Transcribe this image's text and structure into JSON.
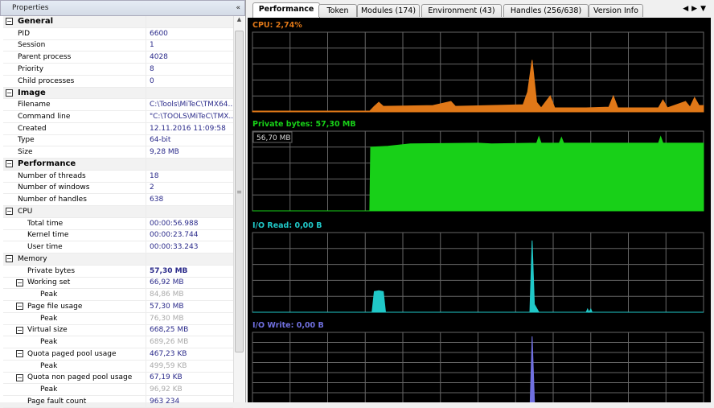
{
  "properties_panel": {
    "title": "Properties",
    "collapse_icon": "«",
    "rows": [
      {
        "k": "cat",
        "name": "General"
      },
      {
        "name": "PID",
        "value": "6600"
      },
      {
        "name": "Session",
        "value": "1"
      },
      {
        "name": "Parent process",
        "value": "4028"
      },
      {
        "name": "Priority",
        "value": "8"
      },
      {
        "name": "Child processes",
        "value": "0"
      },
      {
        "k": "cat",
        "name": "Image"
      },
      {
        "name": "Filename",
        "value": "C:\\Tools\\MiTeC\\TMX64..."
      },
      {
        "name": "Command line",
        "value": "\"C:\\TOOLS\\MiTeC\\TMX..."
      },
      {
        "name": "Created",
        "value": "12.11.2016 11:09:58"
      },
      {
        "name": "Type",
        "value": "64-bit"
      },
      {
        "name": "Size",
        "value": "9,28 MB"
      },
      {
        "k": "cat",
        "name": "Performance"
      },
      {
        "name": "Number of threads",
        "value": "18"
      },
      {
        "name": "Number of windows",
        "value": "2"
      },
      {
        "name": "Number of handles",
        "value": "638"
      },
      {
        "k": "catp",
        "name": "CPU"
      },
      {
        "k": "l2",
        "name": "Total time",
        "value": "00:00:56.988"
      },
      {
        "k": "l2",
        "name": "Kernel time",
        "value": "00:00:23.744"
      },
      {
        "k": "l2",
        "name": "User time",
        "value": "00:00:33.243"
      },
      {
        "k": "catp",
        "name": "Memory"
      },
      {
        "k": "l2b",
        "name": "Private bytes",
        "value": "57,30 MB"
      },
      {
        "k": "sub",
        "name": "Working set",
        "value": "66,92 MB"
      },
      {
        "k": "l3",
        "name": "Peak",
        "value": "84,86 MB"
      },
      {
        "k": "sub",
        "name": "Page file usage",
        "value": "57,30 MB"
      },
      {
        "k": "l3",
        "name": "Peak",
        "value": "76,30 MB"
      },
      {
        "k": "sub",
        "name": "Virtual size",
        "value": "668,25 MB"
      },
      {
        "k": "l3",
        "name": "Peak",
        "value": "689,26 MB"
      },
      {
        "k": "sub",
        "name": "Quota paged pool usage",
        "value": "467,23 KB"
      },
      {
        "k": "l3",
        "name": "Peak",
        "value": "499,59 KB"
      },
      {
        "k": "sub",
        "name": "Quota non paged pool usage",
        "value": "67,19 KB"
      },
      {
        "k": "l3",
        "name": "Peak",
        "value": "96,92 KB"
      },
      {
        "k": "l2",
        "name": "Page fault count",
        "value": "963 234"
      }
    ]
  },
  "tabs": [
    "Performance",
    "Token",
    "Modules (174)",
    "Environment (43)",
    "Handles (256/638)",
    "Version Info"
  ],
  "active_tab": 0,
  "graphs": [
    {
      "label": "CPU: 2,74%",
      "color": "#e07818",
      "rows": 5,
      "points": [
        [
          0,
          0.01
        ],
        [
          26,
          0.01
        ],
        [
          27,
          0.07
        ],
        [
          28,
          0.12
        ],
        [
          29,
          0.07
        ],
        [
          40,
          0.08
        ],
        [
          44,
          0.13
        ],
        [
          45,
          0.07
        ],
        [
          60,
          0.09
        ],
        [
          61,
          0.25
        ],
        [
          62,
          0.65
        ],
        [
          63,
          0.12
        ],
        [
          64,
          0.05
        ],
        [
          66,
          0.2
        ],
        [
          67,
          0.05
        ],
        [
          74,
          0.05
        ],
        [
          79,
          0.06
        ],
        [
          80,
          0.2
        ],
        [
          81,
          0.05
        ],
        [
          90,
          0.05
        ],
        [
          91,
          0.15
        ],
        [
          92,
          0.05
        ],
        [
          96,
          0.13
        ],
        [
          97,
          0.06
        ],
        [
          98,
          0.18
        ],
        [
          99,
          0.08
        ],
        [
          100,
          0.08
        ]
      ]
    },
    {
      "label": "Private bytes: 57,30 MB",
      "color": "#18d018",
      "rows": 5,
      "scale_label": "56,70 MB",
      "points": [
        [
          0,
          0
        ],
        [
          26,
          0
        ],
        [
          26.2,
          0.8
        ],
        [
          30,
          0.81
        ],
        [
          35,
          0.84
        ],
        [
          50,
          0.85
        ],
        [
          53,
          0.84
        ],
        [
          63,
          0.85
        ],
        [
          63.5,
          0.93
        ],
        [
          64,
          0.85
        ],
        [
          68,
          0.85
        ],
        [
          68.5,
          0.92
        ],
        [
          69,
          0.85
        ],
        [
          90,
          0.85
        ],
        [
          90.5,
          0.93
        ],
        [
          91,
          0.85
        ],
        [
          100,
          0.85
        ]
      ]
    },
    {
      "label": "I/O Read: 0,00 B",
      "color": "#20c8c8",
      "rows": 5,
      "points": [
        [
          0,
          0
        ],
        [
          26.5,
          0
        ],
        [
          27,
          0.26
        ],
        [
          28,
          0.27
        ],
        [
          29,
          0.26
        ],
        [
          29.5,
          0
        ],
        [
          61.5,
          0
        ],
        [
          62,
          0.9
        ],
        [
          62.5,
          0.1
        ],
        [
          63.5,
          0
        ],
        [
          74,
          0
        ],
        [
          74.3,
          0.04
        ],
        [
          74.6,
          0
        ],
        [
          75,
          0.04
        ],
        [
          75.3,
          0
        ],
        [
          100,
          0
        ]
      ]
    },
    {
      "label": "I/O Write: 0,00 B",
      "color": "#7070e0",
      "rows": 8,
      "points": [
        [
          0,
          0
        ],
        [
          61.5,
          0
        ],
        [
          62,
          0.95
        ],
        [
          62.6,
          0
        ],
        [
          63.5,
          0
        ],
        [
          63.8,
          0.12
        ],
        [
          64.1,
          0
        ],
        [
          100,
          0
        ]
      ]
    }
  ]
}
